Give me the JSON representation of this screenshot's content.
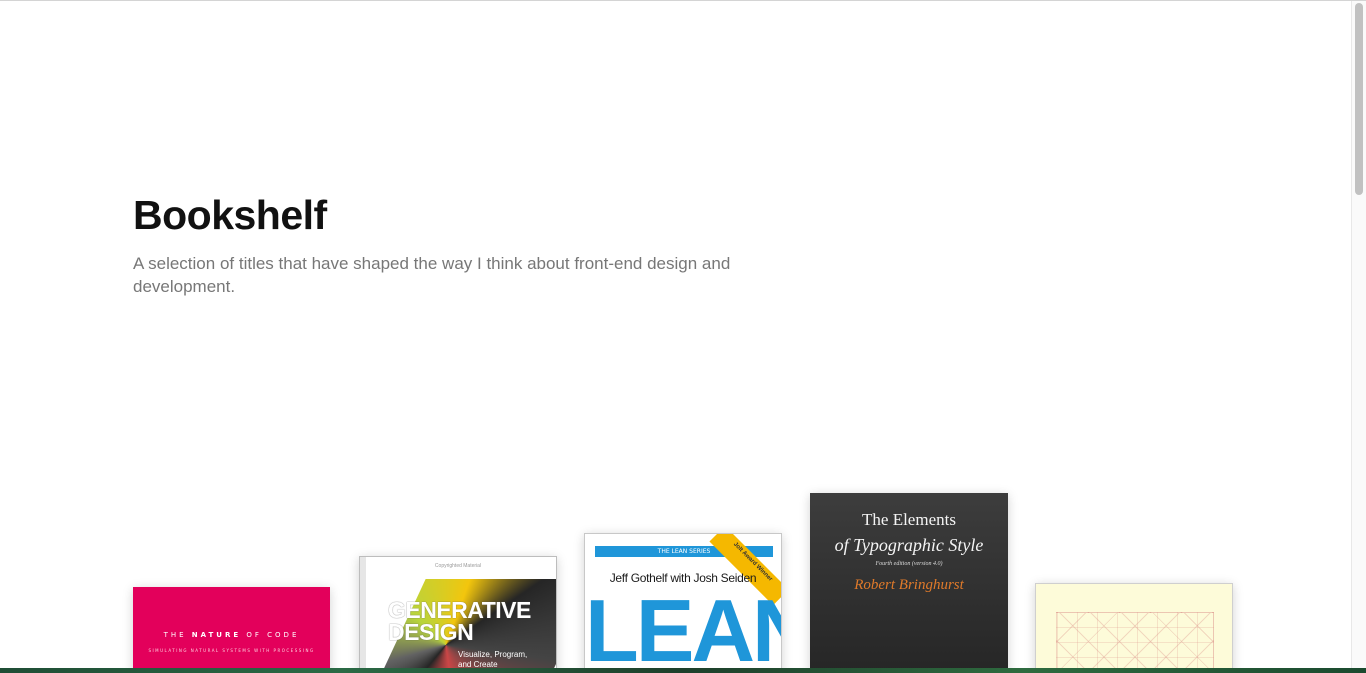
{
  "header": {
    "title": "Bookshelf",
    "intro": "A selection of titles that have shaped the way I think about front-end design and development."
  },
  "books": [
    {
      "cover_color": "#e3005b",
      "title_prefix": "THE ",
      "title_strong": "NATURE",
      "title_suffix": " OF CODE",
      "subtitle": "SIMULATING NATURAL SYSTEMS WITH PROCESSING"
    },
    {
      "copyright_note": "Copyrighted Material",
      "title_line1": "GENERATIVE",
      "title_line2": "DESIGN",
      "subtitle": "Visualize, Program, and Create"
    },
    {
      "series": "THE LEAN SERIES",
      "ribbon": "Jolt Award Winner",
      "authors": "Jeff Gothelf with Josh Seiden",
      "title": "LEAN",
      "accent_color": "#1f96d9"
    },
    {
      "title_line1": "The Elements",
      "title_line2": "of Typographic Style",
      "edition": "Fourth edition (version 4.0)",
      "author": "Robert Bringhurst",
      "accent_color": "#e07a2a"
    },
    {
      "cover_color": "#fdfbd9"
    }
  ],
  "scrollbar": {
    "visible": true
  }
}
